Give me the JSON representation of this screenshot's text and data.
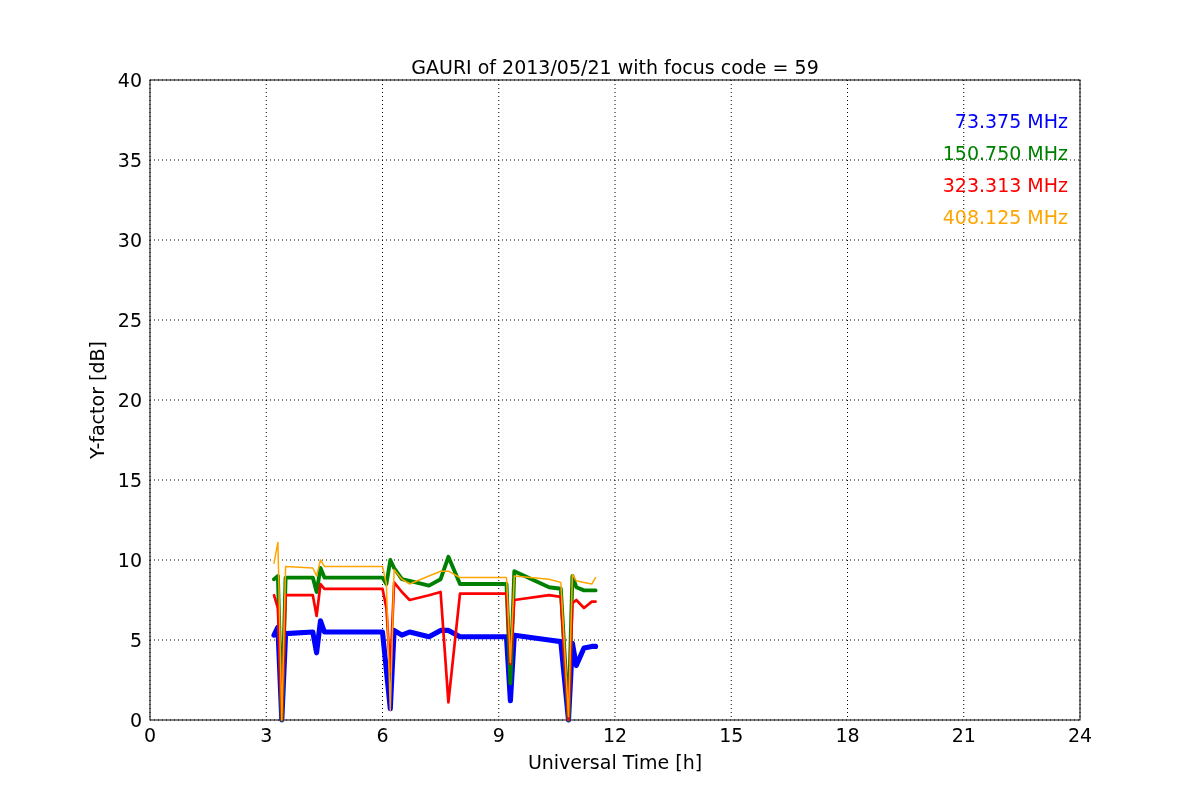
{
  "chart_data": {
    "type": "line",
    "title": "GAURI of 2013/05/21 with focus code = 59",
    "xlabel": "Universal Time [h]",
    "ylabel": "Y-factor [dB]",
    "x": [
      3.2,
      3.3,
      3.4,
      3.5,
      4.2,
      4.3,
      4.4,
      4.5,
      6.0,
      6.1,
      6.2,
      6.3,
      6.5,
      6.7,
      7.2,
      7.5,
      7.7,
      8.0,
      9.2,
      9.3,
      9.4,
      10.3,
      10.6,
      10.8,
      10.9,
      11.0,
      11.2,
      11.4,
      11.5
    ],
    "series": [
      {
        "name": "73.375 MHz",
        "color": "#0000ff",
        "values": [
          5.3,
          5.8,
          0,
          5.4,
          5.5,
          4.2,
          6.2,
          5.5,
          5.5,
          3.1,
          0.7,
          5.6,
          5.3,
          5.5,
          5.2,
          5.6,
          5.6,
          5.2,
          5.2,
          1.2,
          5.3,
          5.0,
          4.9,
          0,
          4.8,
          3.4,
          4.5,
          4.6,
          4.6
        ]
      },
      {
        "name": "150.750 MHz",
        "color": "#008000",
        "values": [
          8.8,
          9.0,
          0,
          8.9,
          8.9,
          8.0,
          9.5,
          8.9,
          8.9,
          8.5,
          10.0,
          9.5,
          8.8,
          8.7,
          8.4,
          8.8,
          10.2,
          8.5,
          8.5,
          2.3,
          9.3,
          8.3,
          8.2,
          0,
          9.0,
          8.3,
          8.1,
          8.1,
          8.1
        ]
      },
      {
        "name": "323.313 MHz",
        "color": "#ff0000",
        "values": [
          7.8,
          7.0,
          0,
          7.8,
          7.8,
          6.5,
          8.5,
          8.2,
          8.2,
          7.0,
          3.0,
          8.6,
          8.0,
          7.5,
          7.8,
          8.0,
          1.1,
          7.9,
          7.9,
          3.5,
          7.5,
          7.8,
          7.7,
          0,
          7.3,
          7.5,
          7.0,
          7.4,
          7.4
        ]
      },
      {
        "name": "408.125 MHz",
        "color": "#ffa500",
        "values": [
          9.8,
          11.1,
          0,
          9.6,
          9.5,
          9.0,
          10.0,
          9.6,
          9.6,
          8.5,
          0.6,
          9.4,
          8.8,
          8.5,
          9.0,
          9.3,
          9.3,
          8.9,
          8.9,
          3.6,
          9.0,
          8.8,
          8.6,
          0.2,
          9.1,
          8.7,
          8.6,
          8.5,
          8.9
        ]
      }
    ],
    "xlim": [
      0,
      24
    ],
    "ylim": [
      0,
      40
    ],
    "xticks": [
      0,
      3,
      6,
      9,
      12,
      15,
      18,
      21,
      24
    ],
    "yticks": [
      0,
      5,
      10,
      15,
      20,
      25,
      30,
      35,
      40
    ],
    "grid": true
  }
}
